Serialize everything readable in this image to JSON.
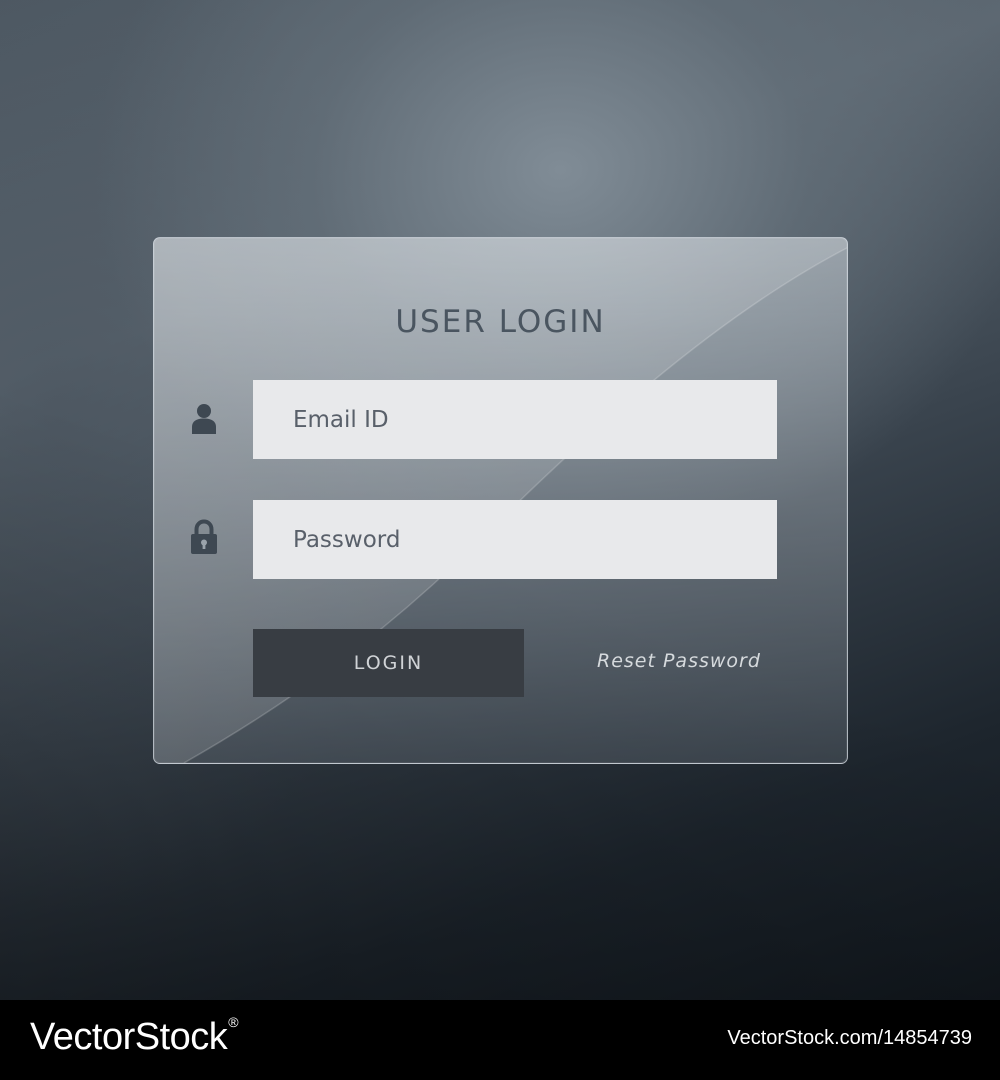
{
  "login_panel": {
    "title": "USER LOGIN",
    "email_field": {
      "placeholder": "Email ID",
      "value": ""
    },
    "password_field": {
      "placeholder": "Password",
      "value": ""
    },
    "login_button_label": "LOGIN",
    "reset_link_label": "Reset Password",
    "icons": {
      "user": "user-icon",
      "lock": "lock-icon"
    }
  },
  "footer": {
    "brand": "VectorStock",
    "brand_mark": "®",
    "image_id": "VectorStock.com/14854739"
  },
  "colors": {
    "background_dark": "#11171d",
    "background_light": "#5d6872",
    "input_fill": "#e8e9eb",
    "button_fill": "#383d43",
    "title_text": "#4a5560",
    "icon": "#3e4852",
    "footer_bar": "#000000"
  }
}
